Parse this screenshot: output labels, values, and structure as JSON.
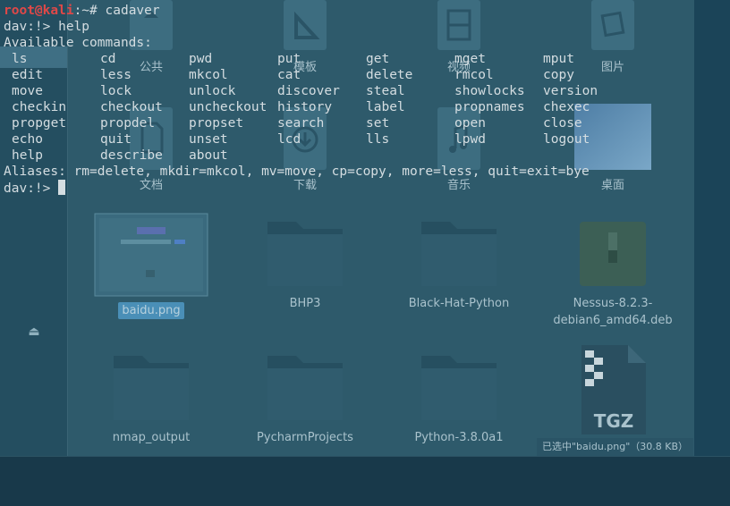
{
  "terminal": {
    "prompt_user": "root@kali",
    "prompt_path": ":~# ",
    "first_command": "cadaver",
    "dav_prompt": "dav:!> ",
    "help_command": "help",
    "available_header": "Available commands:",
    "commands": [
      [
        "ls",
        "cd",
        "pwd",
        "put",
        "get",
        "mget",
        "mput"
      ],
      [
        "edit",
        "less",
        "mkcol",
        "cat",
        "delete",
        "rmcol",
        "copy"
      ],
      [
        "move",
        "lock",
        "unlock",
        "discover",
        "steal",
        "showlocks",
        "version"
      ],
      [
        "checkin",
        "checkout",
        "uncheckout",
        "history",
        "label",
        "propnames",
        "chexec"
      ],
      [
        "propget",
        "propdel",
        "propset",
        "search",
        "set",
        "open",
        "close"
      ],
      [
        "echo",
        "quit",
        "unset",
        "lcd",
        "lls",
        "lpwd",
        "logout"
      ],
      [
        "help",
        "describe",
        "about",
        "",
        "",
        "",
        ""
      ]
    ],
    "aliases": "Aliases: rm=delete, mkdir=mkcol, mv=move, cp=copy, more=less, quit=exit=bye",
    "final_prompt": "dav:!> "
  },
  "file_manager": {
    "top_row": [
      {
        "label": "公共",
        "icon": "public-folder-icon"
      },
      {
        "label": "模板",
        "icon": "templates-folder-icon"
      },
      {
        "label": "视频",
        "icon": "videos-folder-icon"
      },
      {
        "label": "图片",
        "icon": "pictures-folder-icon"
      }
    ],
    "second_row": [
      {
        "label": "文档",
        "icon": "documents-folder-icon"
      },
      {
        "label": "下载",
        "icon": "downloads-folder-icon"
      },
      {
        "label": "音乐",
        "icon": "music-folder-icon"
      },
      {
        "label": "桌面",
        "icon": "desktop-folder-icon"
      }
    ],
    "third_row": [
      {
        "label": "baidu.png",
        "icon": "image-thumbnail-icon",
        "selected": true
      },
      {
        "label": "BHP3",
        "icon": "folder-icon"
      },
      {
        "label": "Black-Hat-Python",
        "icon": "folder-icon"
      },
      {
        "label": "Nessus-8.2.3-debian6_amd64.deb",
        "label_line1": "Nessus-8.2.3-",
        "label_line2": "debian6_amd64.deb",
        "icon": "deb-package-icon"
      }
    ],
    "fourth_row": [
      {
        "label": "nmap_output",
        "icon": "folder-icon"
      },
      {
        "label": "PycharmProjects",
        "icon": "folder-icon"
      },
      {
        "label": "Python-3.8.0a1",
        "icon": "folder-icon"
      },
      {
        "label": "TGZ",
        "icon": "tgz-archive-icon"
      }
    ],
    "status": "已选中\"baidu.png\"（30.8 KB）"
  }
}
